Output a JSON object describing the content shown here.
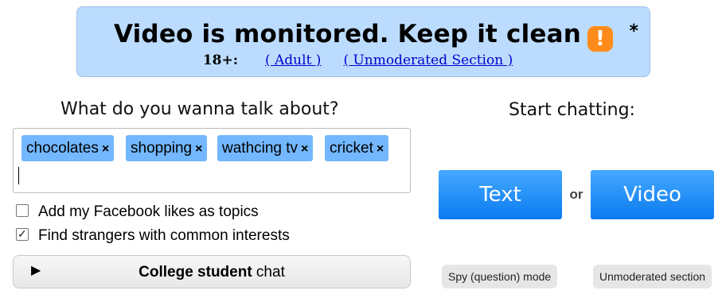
{
  "banner": {
    "title": "Video is monitored. Keep it clean",
    "warning_icon_glyph": "!",
    "star": "*",
    "age_label": "18+:",
    "adult_link": "( Adult )",
    "unmoderated_link": "( Unmoderated Section )"
  },
  "topics": {
    "heading": "What do you wanna talk about?",
    "tags": [
      {
        "label": "chocolates",
        "remove": "×"
      },
      {
        "label": "shopping",
        "remove": "×"
      },
      {
        "label": "wathcing tv",
        "remove": "×"
      },
      {
        "label": "cricket",
        "remove": "×"
      }
    ]
  },
  "options": {
    "facebook_likes": {
      "label": "Add my Facebook likes as topics",
      "checked": false
    },
    "common_interests": {
      "label": "Find strangers with common interests",
      "checked": true,
      "tick": "✓"
    }
  },
  "college": {
    "play_glyph": "▶",
    "bold_text": "College student",
    "text": " chat"
  },
  "chat": {
    "heading": "Start chatting:",
    "text_button": "Text",
    "or": "or",
    "video_button": "Video",
    "spy_button": "Spy (question) mode",
    "unmoderated_button": "Unmoderated section"
  },
  "colors": {
    "banner_bg": "#bcdcff",
    "tag_bg": "#73b7ff",
    "button_blue": "#1a8cff",
    "warning_orange": "#ff8c1a"
  }
}
